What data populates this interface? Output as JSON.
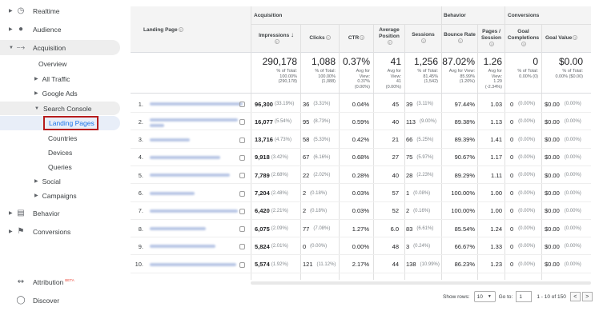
{
  "sidebar": {
    "realtime": "Realtime",
    "audience": "Audience",
    "acquisition": "Acquisition",
    "overview": "Overview",
    "all_traffic": "All Traffic",
    "google_ads": "Google Ads",
    "search_console": "Search Console",
    "landing_pages": "Landing Pages",
    "countries": "Countries",
    "devices": "Devices",
    "queries": "Queries",
    "social": "Social",
    "campaigns": "Campaigns",
    "behavior": "Behavior",
    "conversions": "Conversions",
    "attribution": "Attribution",
    "attribution_badge": "BETA",
    "discover": "Discover"
  },
  "table": {
    "landing_page_header": "Landing Page",
    "groups": {
      "acquisition": "Acquisition",
      "behavior": "Behavior",
      "conversions": "Conversions"
    },
    "columns": {
      "impressions": "Impressions",
      "clicks": "Clicks",
      "ctr": "CTR",
      "avg_position_l1": "Average",
      "avg_position_l2": "Position",
      "sessions": "Sessions",
      "bounce_rate": "Bounce Rate",
      "pages_l1": "Pages /",
      "pages_l2": "Session",
      "goal_l1": "Goal",
      "goal_l2": "Completions",
      "goal_value": "Goal Value"
    },
    "totals": {
      "impressions": "290,178",
      "impressions_sub1": "% of Total:",
      "impressions_sub2": "100.00%",
      "impressions_sub3": "(290,178)",
      "clicks": "1,088",
      "clicks_sub1": "% of Total:",
      "clicks_sub2": "100.00%",
      "clicks_sub3": "(1,088)",
      "ctr": "0.37%",
      "ctr_sub1": "Avg for",
      "ctr_sub2": "View:",
      "ctr_sub3": "0.37%",
      "ctr_sub4": "(0.00%)",
      "position": "41",
      "position_sub1": "Avg for",
      "position_sub2": "View:",
      "position_sub3": "41",
      "position_sub4": "(0.00%)",
      "sessions": "1,256",
      "sessions_sub1": "% of Total:",
      "sessions_sub2": "81.45%",
      "sessions_sub3": "(1,542)",
      "bounce": "87.02%",
      "bounce_sub1": "Avg for View:",
      "bounce_sub2": "85.99%",
      "bounce_sub3": "(1.20%)",
      "pages": "1.26",
      "pages_sub1": "Avg for",
      "pages_sub2": "View:",
      "pages_sub3": "1.29",
      "pages_sub4": "(-2.34%)",
      "goal": "0",
      "goal_sub1": "% of Total:",
      "goal_sub2": "0.00% (0)",
      "value": "$0.00",
      "value_sub1": "% of Total:",
      "value_sub2": "0.00% ($0.00)"
    },
    "rows": [
      {
        "n": "1.",
        "imp": "96,300",
        "imp_p": "(33.19%)",
        "clicks": "36",
        "clicks_p": "(3.31%)",
        "ctr": "0.04%",
        "pos": "45",
        "ses": "39",
        "ses_p": "(3.11%)",
        "bounce": "97.44%",
        "pps": "1.03",
        "goal": "0",
        "goal_p": "(0.00%)",
        "val": "$0.00",
        "val_p": "(0.00%)"
      },
      {
        "n": "2.",
        "imp": "16,077",
        "imp_p": "(5.54%)",
        "clicks": "95",
        "clicks_p": "(8.73%)",
        "ctr": "0.59%",
        "pos": "40",
        "ses": "113",
        "ses_p": "(9.00%)",
        "bounce": "89.38%",
        "pps": "1.13",
        "goal": "0",
        "goal_p": "(0.00%)",
        "val": "$0.00",
        "val_p": "(0.00%)"
      },
      {
        "n": "3.",
        "imp": "13,716",
        "imp_p": "(4.73%)",
        "clicks": "58",
        "clicks_p": "(5.33%)",
        "ctr": "0.42%",
        "pos": "21",
        "ses": "66",
        "ses_p": "(5.25%)",
        "bounce": "89.39%",
        "pps": "1.41",
        "goal": "0",
        "goal_p": "(0.00%)",
        "val": "$0.00",
        "val_p": "(0.00%)"
      },
      {
        "n": "4.",
        "imp": "9,918",
        "imp_p": "(3.42%)",
        "clicks": "67",
        "clicks_p": "(6.16%)",
        "ctr": "0.68%",
        "pos": "27",
        "ses": "75",
        "ses_p": "(5.97%)",
        "bounce": "90.67%",
        "pps": "1.17",
        "goal": "0",
        "goal_p": "(0.00%)",
        "val": "$0.00",
        "val_p": "(0.00%)"
      },
      {
        "n": "5.",
        "imp": "7,789",
        "imp_p": "(2.68%)",
        "clicks": "22",
        "clicks_p": "(2.02%)",
        "ctr": "0.28%",
        "pos": "40",
        "ses": "28",
        "ses_p": "(2.23%)",
        "bounce": "89.29%",
        "pps": "1.11",
        "goal": "0",
        "goal_p": "(0.00%)",
        "val": "$0.00",
        "val_p": "(0.00%)"
      },
      {
        "n": "6.",
        "imp": "7,204",
        "imp_p": "(2.48%)",
        "clicks": "2",
        "clicks_p": "(0.18%)",
        "ctr": "0.03%",
        "pos": "57",
        "ses": "1",
        "ses_p": "(0.08%)",
        "bounce": "100.00%",
        "pps": "1.00",
        "goal": "0",
        "goal_p": "(0.00%)",
        "val": "$0.00",
        "val_p": "(0.00%)"
      },
      {
        "n": "7.",
        "imp": "6,420",
        "imp_p": "(2.21%)",
        "clicks": "2",
        "clicks_p": "(0.18%)",
        "ctr": "0.03%",
        "pos": "52",
        "ses": "2",
        "ses_p": "(0.16%)",
        "bounce": "100.00%",
        "pps": "1.00",
        "goal": "0",
        "goal_p": "(0.00%)",
        "val": "$0.00",
        "val_p": "(0.00%)"
      },
      {
        "n": "8.",
        "imp": "6,075",
        "imp_p": "(2.09%)",
        "clicks": "77",
        "clicks_p": "(7.08%)",
        "ctr": "1.27%",
        "pos": "6.0",
        "ses": "83",
        "ses_p": "(6.61%)",
        "bounce": "85.54%",
        "pps": "1.24",
        "goal": "0",
        "goal_p": "(0.00%)",
        "val": "$0.00",
        "val_p": "(0.00%)"
      },
      {
        "n": "9.",
        "imp": "5,824",
        "imp_p": "(2.01%)",
        "clicks": "0",
        "clicks_p": "(0.00%)",
        "ctr": "0.00%",
        "pos": "48",
        "ses": "3",
        "ses_p": "(0.24%)",
        "bounce": "66.67%",
        "pps": "1.33",
        "goal": "0",
        "goal_p": "(0.00%)",
        "val": "$0.00",
        "val_p": "(0.00%)"
      },
      {
        "n": "10.",
        "imp": "5,574",
        "imp_p": "(1.92%)",
        "clicks": "121",
        "clicks_p": "(11.12%)",
        "ctr": "2.17%",
        "pos": "44",
        "ses": "138",
        "ses_p": "(10.99%)",
        "bounce": "86.23%",
        "pps": "1.23",
        "goal": "0",
        "goal_p": "(0.00%)",
        "val": "$0.00",
        "val_p": "(0.00%)"
      }
    ]
  },
  "footer": {
    "show_rows_label": "Show rows:",
    "show_rows_value": "10",
    "goto_label": "Go to:",
    "goto_value": "1",
    "range": "1 - 10 of 150",
    "prev": "<",
    "next": ">"
  }
}
